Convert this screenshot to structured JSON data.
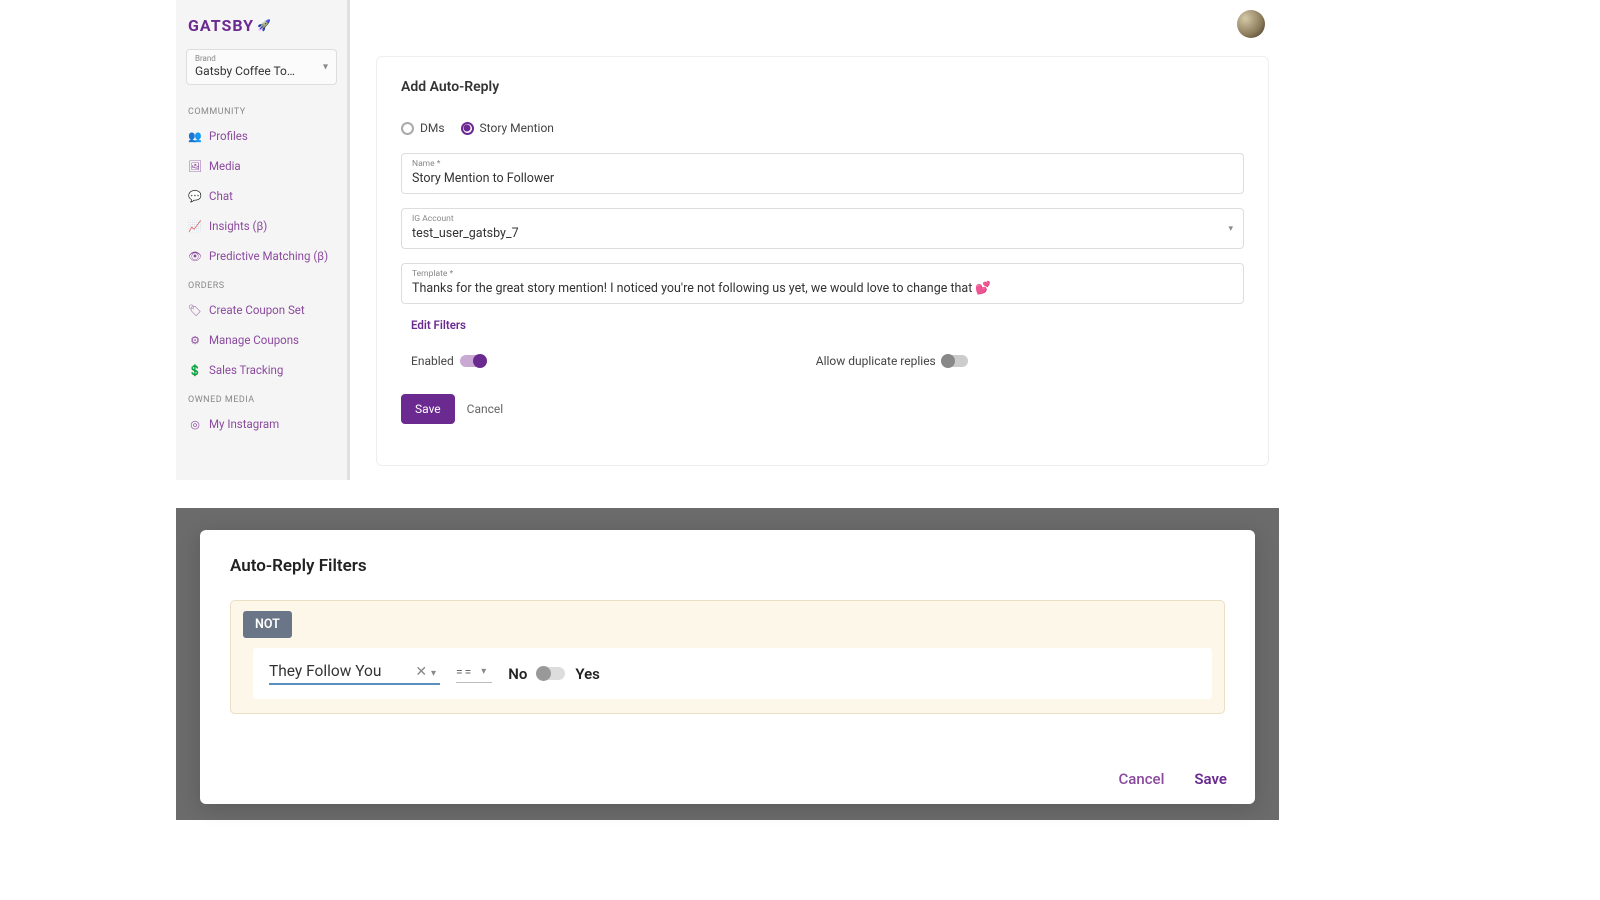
{
  "logo_text": "GATSBY",
  "sidebar": {
    "brand": {
      "label": "Brand",
      "value": "Gatsby Coffee To…"
    },
    "sections": [
      {
        "header": "COMMUNITY",
        "items": [
          {
            "icon": "👥",
            "label": "Profiles",
            "name": "profiles"
          },
          {
            "icon": "🖼",
            "label": "Media",
            "name": "media"
          },
          {
            "icon": "💬",
            "label": "Chat",
            "name": "chat"
          },
          {
            "icon": "📈",
            "label": "Insights (β)",
            "name": "insights"
          },
          {
            "icon": "👁",
            "label": "Predictive Matching (β)",
            "name": "predictive"
          }
        ]
      },
      {
        "header": "ORDERS",
        "items": [
          {
            "icon": "🏷",
            "label": "Create Coupon Set",
            "name": "create-coupon"
          },
          {
            "icon": "⚙",
            "label": "Manage Coupons",
            "name": "manage-coupons"
          },
          {
            "icon": "💲",
            "label": "Sales Tracking",
            "name": "sales-tracking"
          }
        ]
      },
      {
        "header": "OWNED MEDIA",
        "items": [
          {
            "icon": "◎",
            "label": "My Instagram",
            "name": "my-instagram"
          }
        ]
      }
    ]
  },
  "form": {
    "title": "Add Auto-Reply",
    "radios": {
      "dms": "DMs",
      "story_mention": "Story Mention"
    },
    "fields": {
      "name": {
        "label": "Name *",
        "value": "Story Mention to Follower"
      },
      "ig_account": {
        "label": "IG Account",
        "value": "test_user_gatsby_7"
      },
      "template": {
        "label": "Template *",
        "value": "Thanks for the great story mention! I noticed you're not following us yet, we would love to change that 💕"
      }
    },
    "edit_filters": "Edit Filters",
    "toggles": {
      "enabled": "Enabled",
      "duplicates": "Allow duplicate replies"
    },
    "buttons": {
      "save": "Save",
      "cancel": "Cancel"
    }
  },
  "modal": {
    "title": "Auto-Reply Filters",
    "not_badge": "NOT",
    "condition": {
      "field": "They Follow You",
      "operator": "==",
      "no": "No",
      "yes": "Yes"
    },
    "buttons": {
      "cancel": "Cancel",
      "save": "Save"
    }
  }
}
